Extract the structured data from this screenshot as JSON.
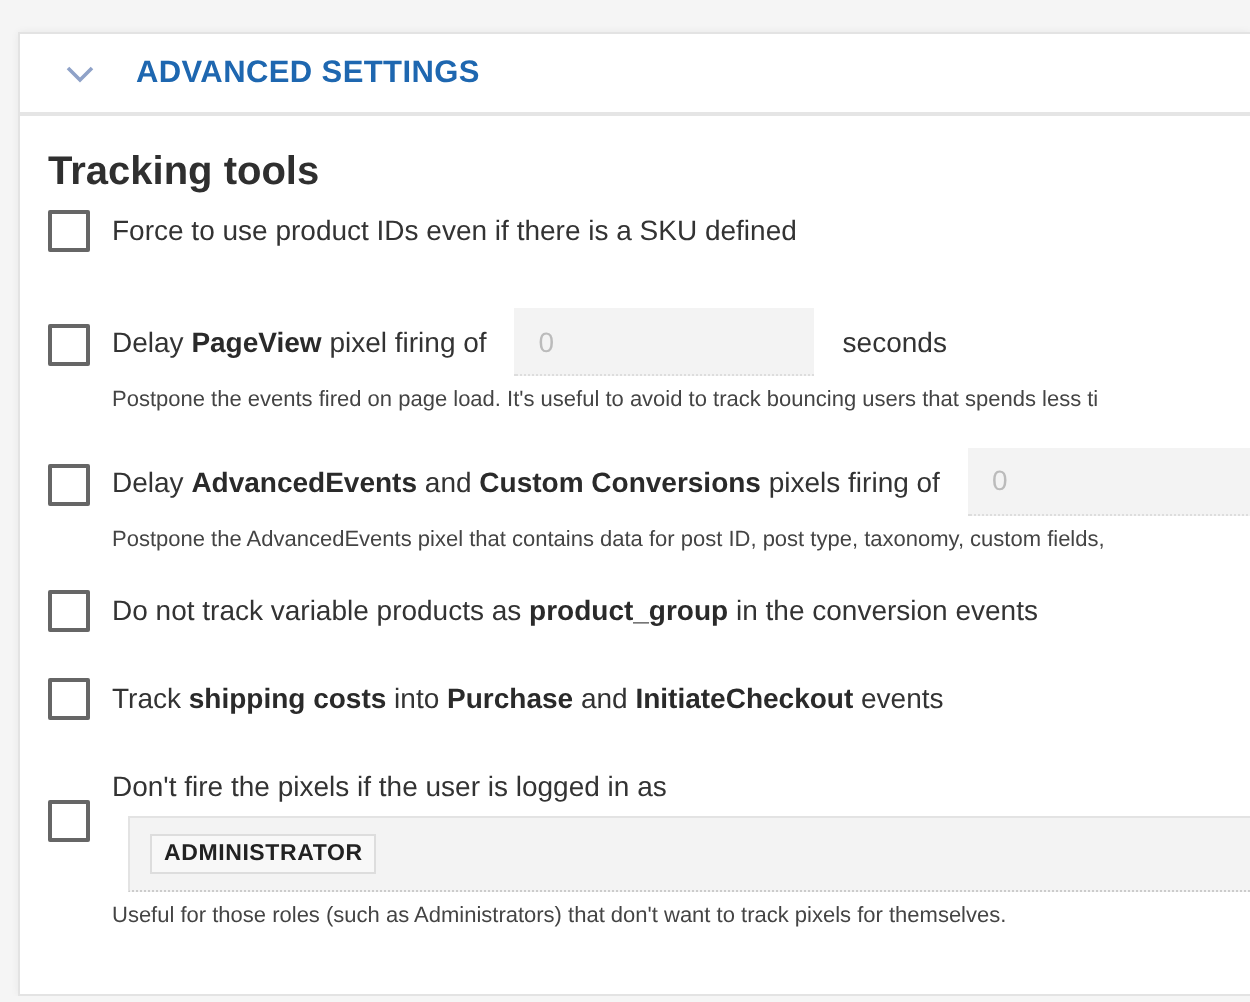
{
  "panel": {
    "title": "ADVANCED SETTINGS",
    "expanded": true
  },
  "section": {
    "title": "Tracking tools"
  },
  "options": [
    {
      "kind": "checkbox",
      "checked": false,
      "label": "Force to use product IDs even if there is a SKU defined"
    },
    {
      "kind": "delay",
      "checked": false,
      "label": "Delay **PageView** pixel firing of",
      "placeholder": "0",
      "suffix": "seconds",
      "description": "Postpone the events fired on page load. It's useful to avoid to track bouncing users that spends less ti"
    },
    {
      "kind": "delay",
      "checked": false,
      "label": "Delay **AdvancedEvents** and **Custom Conversions** pixels firing of",
      "placeholder": "0",
      "description": "Postpone the AdvancedEvents pixel that contains data for post ID, post type, taxonomy, custom fields,"
    },
    {
      "kind": "checkbox",
      "checked": false,
      "label": "Do not track variable products as **product_group** in the conversion events"
    },
    {
      "kind": "checkbox",
      "checked": false,
      "label": "Track **shipping costs** into **Purchase** and **InitiateCheckout** events"
    },
    {
      "kind": "roles",
      "checked": false,
      "label": "Don't fire the pixels if the user is logged in as",
      "tags": [
        "ADMINISTRATOR"
      ],
      "description": "Useful for those roles (such as Administrators) that don't want to track pixels for themselves."
    }
  ]
}
